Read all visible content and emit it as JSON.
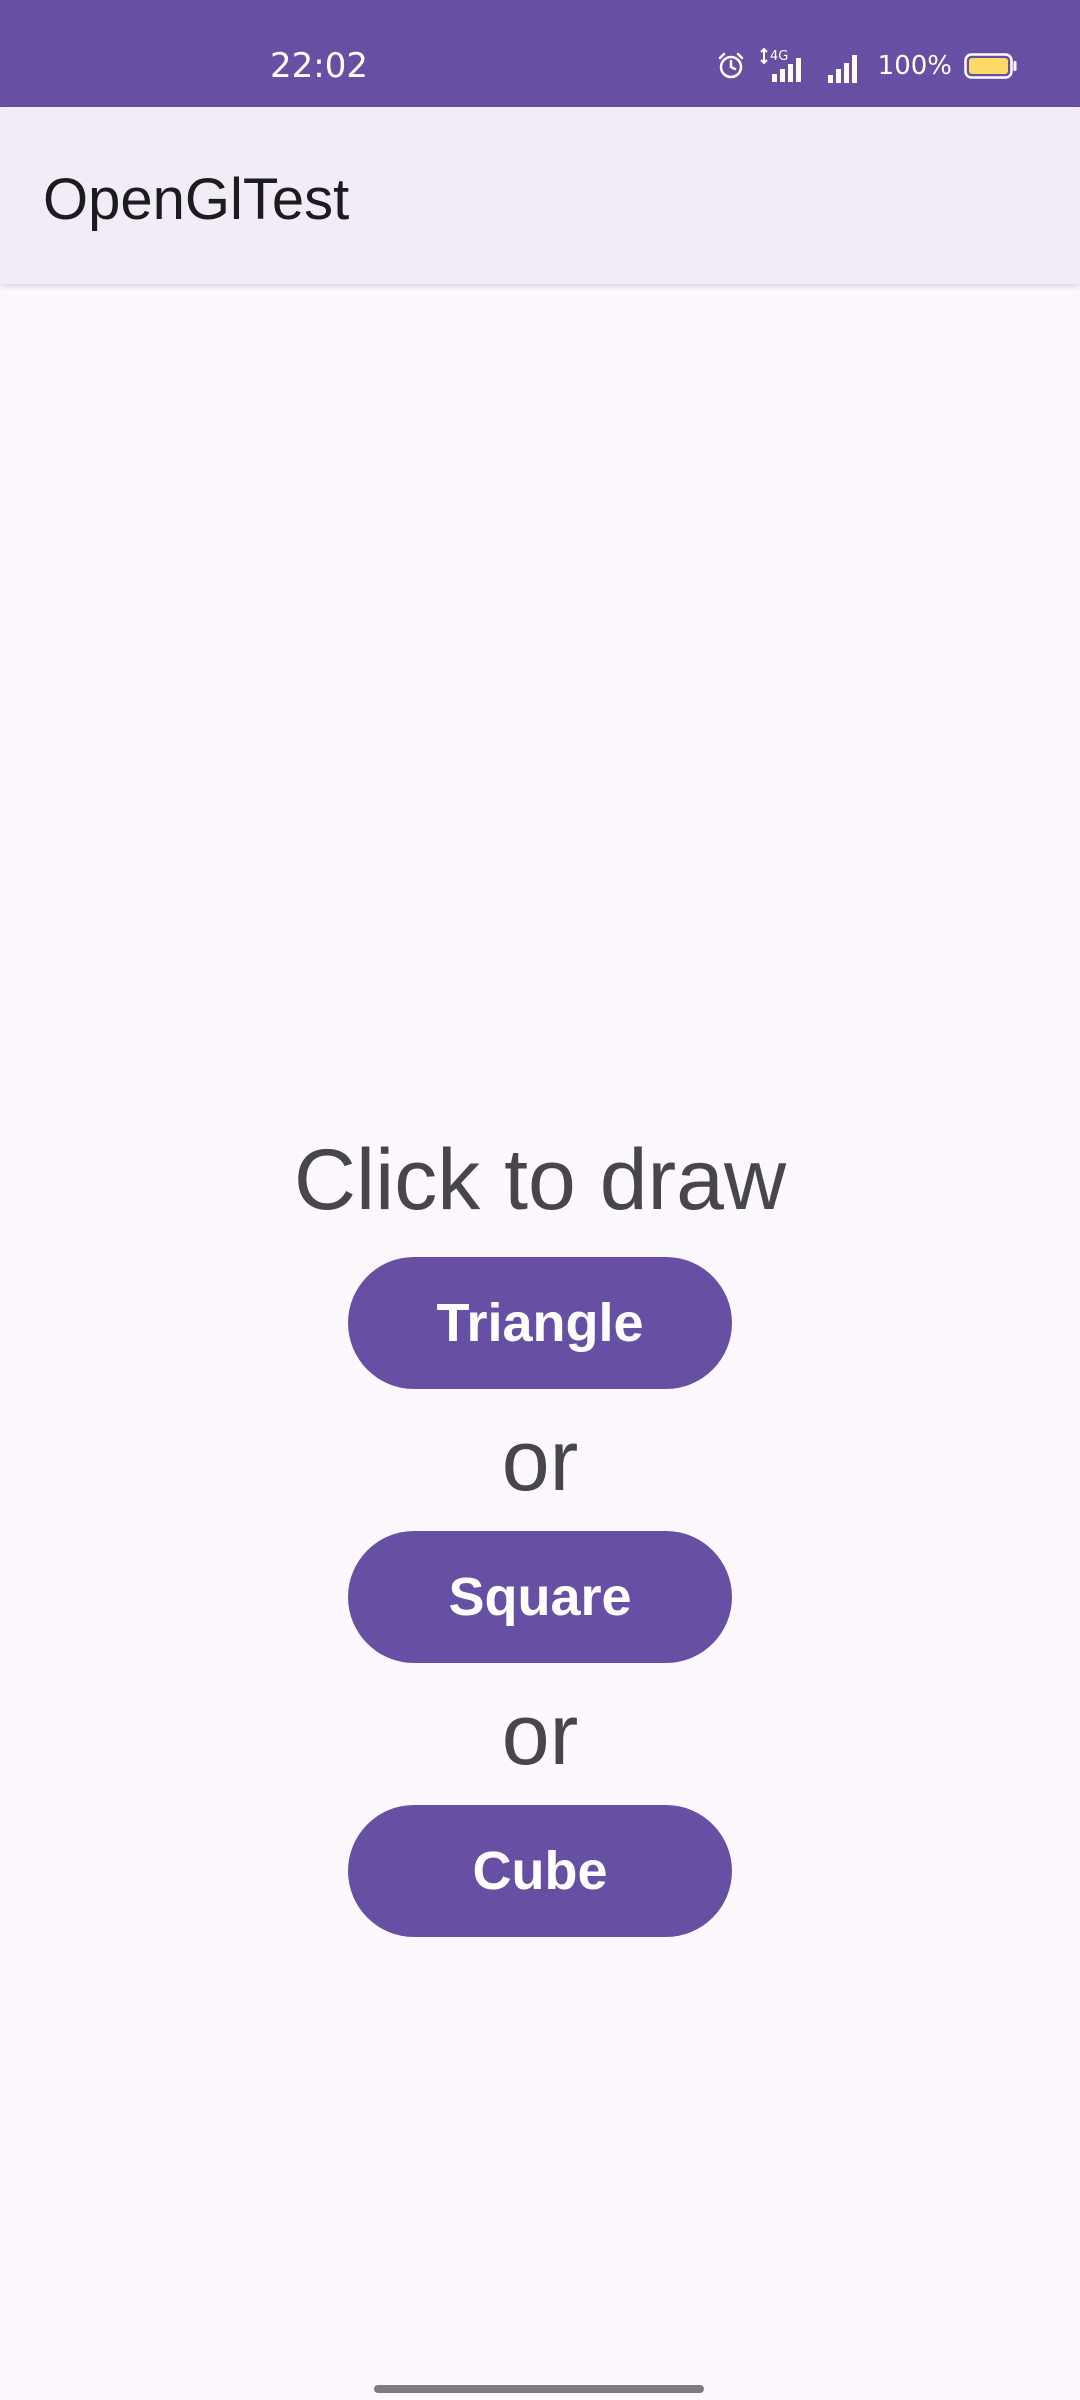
{
  "status_bar": {
    "time": "22:02",
    "network_label": "4G",
    "battery_text": "100%",
    "icons": [
      "alarm-icon",
      "mobile-data-icon",
      "signal-icon",
      "signal-icon-2",
      "battery-icon"
    ],
    "battery_level": 1.0,
    "battery_color": "#ffd966"
  },
  "app_bar": {
    "title": "OpenGlTest"
  },
  "main": {
    "prompt": "Click to draw",
    "buttons": [
      {
        "label": "Triangle"
      },
      {
        "label": "Square"
      },
      {
        "label": "Cube"
      }
    ],
    "separator": "or"
  },
  "colors": {
    "primary": "#6750a4",
    "background": "#fdf8fd",
    "app_bar": "#f1ecf5",
    "text": "#47454d"
  }
}
